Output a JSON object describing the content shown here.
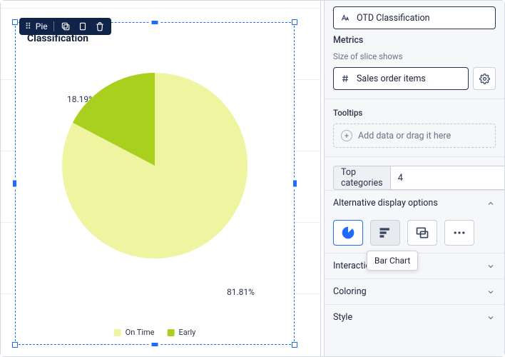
{
  "floatbar": {
    "label": "Pie"
  },
  "chart": {
    "title": "Classification",
    "label_a": "18.19%",
    "label_b": "81.81%",
    "legend": [
      {
        "label": "On Time",
        "color": "#eef4a0"
      },
      {
        "label": "Early",
        "color": "#a9cf1f"
      }
    ]
  },
  "chart_data": {
    "type": "pie",
    "title": "Classification",
    "categories": [
      "On Time",
      "Early"
    ],
    "values": [
      81.81,
      18.19
    ],
    "colors": [
      "#eef4a0",
      "#a9cf1f"
    ],
    "value_suffix": "%"
  },
  "panel": {
    "otd_field": "OTD Classification",
    "metrics_label": "Metrics",
    "metrics_hint": "Size of slice shows",
    "metric_field": "Sales order items",
    "tooltips_label": "Tooltips",
    "dropzone_text": "Add data or drag it here",
    "topcat_label": "Top categories",
    "topcat_value": "4",
    "alt_display_label": "Alternative display options",
    "tooltip_text": "Bar Chart",
    "sections": {
      "interactions": "Interactions",
      "coloring": "Coloring",
      "style": "Style"
    }
  }
}
